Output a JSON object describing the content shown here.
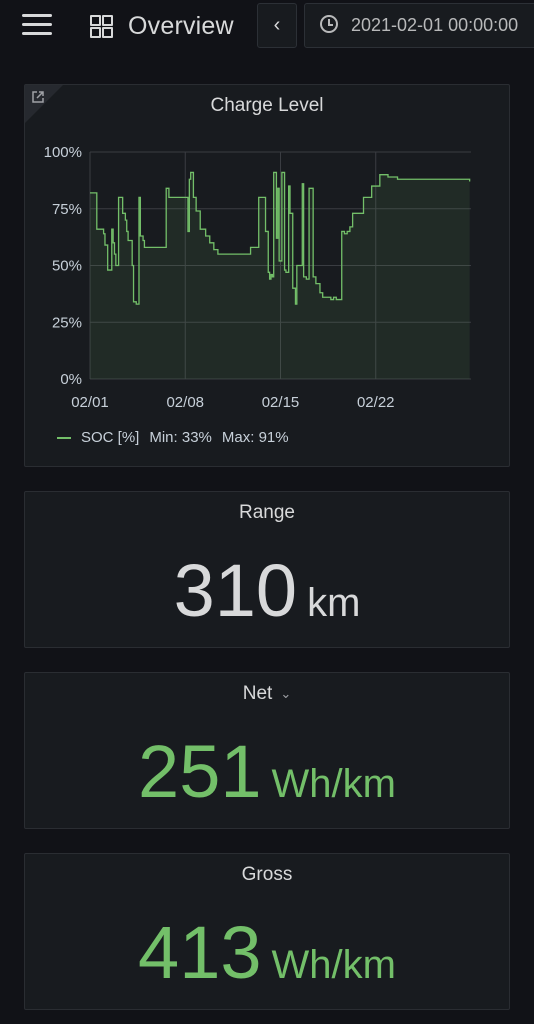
{
  "header": {
    "title": "Overview",
    "time_range": "2021-02-01 00:00:00"
  },
  "charge_panel": {
    "title": "Charge Level",
    "legend": {
      "series": "SOC [%]",
      "min": "Min: 33%",
      "max": "Max: 91%"
    }
  },
  "chart_data": {
    "type": "line",
    "title": "Charge Level",
    "ylim": [
      0,
      100
    ],
    "yticks": [
      "0%",
      "25%",
      "50%",
      "75%",
      "100%"
    ],
    "xticks": [
      "02/01",
      "02/08",
      "02/15",
      "02/22"
    ],
    "x_domain_days": [
      0,
      28
    ],
    "grid": true,
    "legend_position": "bottom",
    "series": [
      {
        "name": "SOC [%]",
        "color": "#73bf69",
        "x": [
          0.0,
          0.5,
          0.5,
          1.0,
          1.1,
          1.3,
          1.6,
          1.6,
          1.7,
          1.8,
          1.9,
          2.1,
          2.3,
          2.4,
          2.6,
          2.7,
          2.8,
          3.1,
          3.2,
          3.4,
          3.6,
          3.7,
          3.7,
          3.9,
          4.0,
          4.1,
          4.3,
          4.6,
          5.0,
          5.3,
          5.6,
          5.8,
          6.0,
          6.3,
          6.6,
          6.9,
          7.1,
          7.2,
          7.3,
          7.4,
          7.6,
          7.8,
          8.1,
          8.3,
          8.5,
          8.8,
          9.1,
          9.4,
          9.8,
          10.2,
          10.6,
          11.0,
          11.4,
          11.8,
          12.2,
          12.4,
          12.6,
          12.9,
          13.1,
          13.2,
          13.3,
          13.4,
          13.5,
          13.7,
          13.8,
          13.9,
          14.1,
          14.3,
          14.4,
          14.6,
          14.7,
          14.9,
          15.1,
          15.2,
          15.4,
          15.6,
          15.7,
          15.9,
          16.1,
          16.4,
          16.6,
          16.9,
          17.1,
          17.3,
          17.5,
          17.7,
          17.9,
          18.1,
          18.3,
          18.5,
          18.7,
          18.9,
          19.1,
          19.3,
          19.5,
          19.8,
          20.1,
          20.4,
          20.6,
          20.7,
          20.9,
          21.0,
          21.1,
          21.3,
          21.6,
          21.9,
          22.2,
          22.6,
          23.0,
          23.3,
          23.7,
          24.1,
          24.5,
          24.8,
          25.2,
          25.6,
          26.0,
          26.4,
          26.8,
          27.2,
          27.5,
          27.8,
          27.9
        ],
        "values": [
          82,
          80,
          66,
          64,
          59,
          48,
          52,
          66,
          60,
          55,
          50,
          80,
          80,
          73,
          70,
          65,
          61,
          50,
          34,
          33,
          80,
          78,
          63,
          61,
          58,
          58,
          58,
          58,
          58,
          58,
          84,
          80,
          80,
          80,
          80,
          80,
          80,
          65,
          88,
          91,
          80,
          74,
          66,
          66,
          63,
          60,
          57,
          55,
          55,
          55,
          55,
          55,
          55,
          58,
          58,
          80,
          80,
          65,
          47,
          44,
          46,
          45,
          91,
          62,
          84,
          52,
          91,
          48,
          47,
          85,
          73,
          40,
          33,
          50,
          50,
          86,
          45,
          44,
          84,
          45,
          42,
          38,
          36,
          36,
          36,
          35,
          36,
          35,
          35,
          65,
          64,
          65,
          67,
          73,
          73,
          73,
          80,
          80,
          80,
          85,
          85,
          85,
          85,
          90,
          90,
          89,
          89,
          88,
          88,
          88,
          88,
          88,
          88,
          88,
          88,
          88,
          88,
          88,
          88,
          88,
          88,
          88,
          87
        ]
      }
    ]
  },
  "range_panel": {
    "title": "Range",
    "value": "310",
    "unit": "km",
    "color": "#d8d9da"
  },
  "net_panel": {
    "title": "Net",
    "value": "251",
    "unit": "Wh/km",
    "color": "#73bf69"
  },
  "gross_panel": {
    "title": "Gross",
    "value": "413",
    "unit": "Wh/km",
    "color": "#73bf69"
  }
}
